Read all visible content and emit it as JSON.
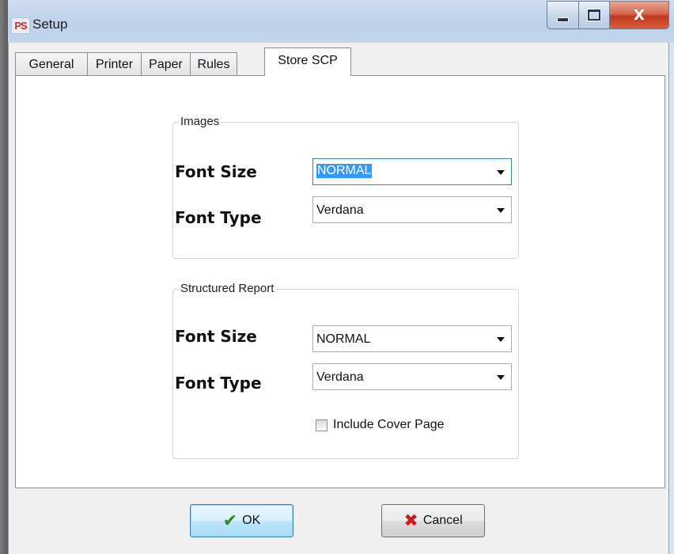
{
  "window": {
    "app_icon_text": "PS",
    "title": "Setup",
    "buttons": {
      "minimize_icon": "minimize-icon",
      "maximize_icon": "maximize-icon",
      "close_label": "X"
    }
  },
  "tabs": [
    {
      "label": "General"
    },
    {
      "label": "Printer"
    },
    {
      "label": "Paper"
    },
    {
      "label": "Rules"
    },
    {
      "label": "Store SCP"
    }
  ],
  "active_tab": "Store SCP",
  "images_group": {
    "legend": "Images",
    "font_size_label": "Font Size",
    "font_size_value": "NORMAL",
    "font_type_label": "Font Type",
    "font_type_value": "Verdana"
  },
  "sr_group": {
    "legend": "Structured Report",
    "font_size_label": "Font Size",
    "font_size_value": "NORMAL",
    "font_type_label": "Font Type",
    "font_type_value": "Verdana",
    "cover_page_label": "Include Cover Page",
    "cover_page_checked": false
  },
  "footer": {
    "ok_label": "OK",
    "cancel_label": "Cancel"
  },
  "colors": {
    "selection": "#3399ff",
    "ok_icon": "#2a8a1f",
    "cancel_icon": "#c8201c",
    "close_button": "#c2381f"
  }
}
